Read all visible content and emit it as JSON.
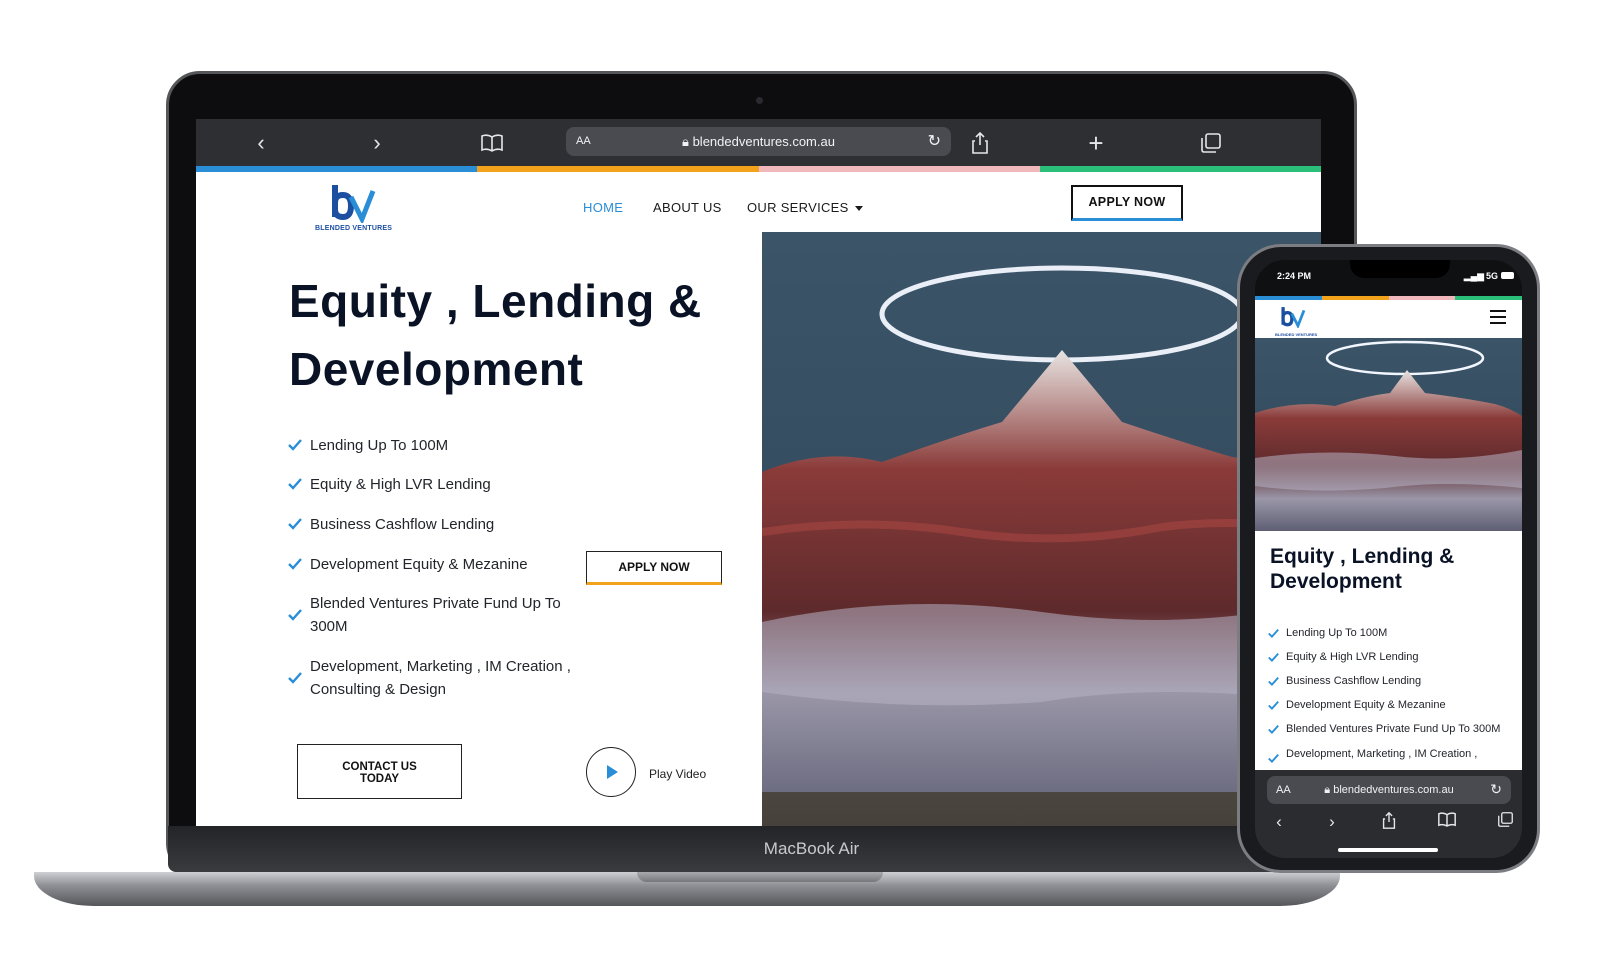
{
  "colors": {
    "accent_blue": "#2a8ed6",
    "stripe_blue": "#2a8ed6",
    "stripe_orange": "#f2a21b",
    "stripe_pink": "#f0b7bd",
    "stripe_green": "#2bc07a",
    "navy": "#0a1325",
    "logo_blue": "#1c4fa0"
  },
  "laptop": {
    "model_label": "MacBook Air",
    "browser": {
      "url": "blendedventures.com.au",
      "text_size_label": "AA"
    },
    "site": {
      "logo_text": "BLENDED VENTURES",
      "nav": {
        "home": "HOME",
        "about": "ABOUT US",
        "services": "OUR SERVICES"
      },
      "apply_top": "APPLY NOW",
      "hero_title_line1": "Equity , Lending &",
      "hero_title_line2": "Development",
      "features": [
        "Lending Up To 100M",
        "Equity & High LVR Lending",
        "Business Cashflow Lending",
        "Development Equity & Mezanine",
        "Blended Ventures Private Fund Up To 300M",
        "Development, Marketing , IM Creation , Consulting & Design"
      ],
      "apply_mid": "APPLY NOW",
      "contact_line1": "CONTACT US",
      "contact_line2": "TODAY",
      "play_label": "Play Video"
    }
  },
  "phone": {
    "status_time": "2:24 PM",
    "status_signal": "5G",
    "logo_text": "BLENDED VENTURES",
    "hero_title_line1": "Equity , Lending &",
    "hero_title_line2": "Development",
    "features": [
      "Lending Up To 100M",
      "Equity & High LVR Lending",
      "Business Cashflow Lending",
      "Development Equity & Mezanine",
      "Blended Ventures Private Fund Up To 300M",
      "Development, Marketing , IM Creation ,"
    ],
    "browser": {
      "url": "blendedventures.com.au",
      "text_size_label": "AA"
    }
  }
}
